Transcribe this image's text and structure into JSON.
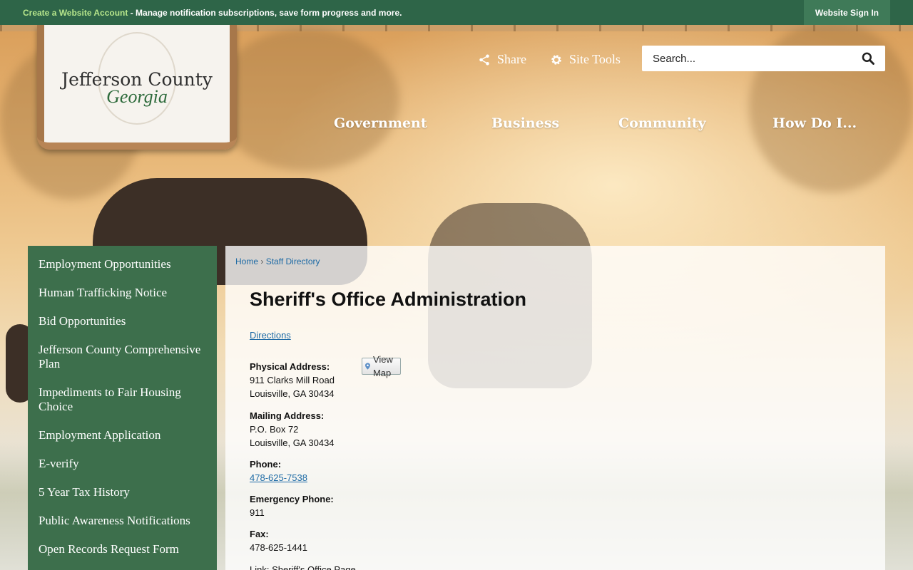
{
  "topbar": {
    "account_link": "Create a Website Account",
    "account_text": " - Manage notification subscriptions, save form progress and more.",
    "sign_in": "Website Sign In"
  },
  "logo": {
    "county": "Jefferson County",
    "state": "Georgia"
  },
  "header": {
    "share_label": "Share",
    "tools_label": "Site Tools",
    "search_placeholder": "Search..."
  },
  "nav": {
    "items": [
      "Government",
      "Business",
      "Community",
      "How Do I..."
    ]
  },
  "sidebar": {
    "items": [
      "Employment Opportunities",
      "Human Trafficking Notice",
      "Bid Opportunities",
      "Jefferson County Comprehensive Plan",
      "Impediments to Fair Housing Choice",
      "Employment Application",
      "E-verify",
      "5 Year Tax History",
      "Public Awareness Notifications",
      "Open Records Request Form"
    ]
  },
  "breadcrumb": {
    "home": "Home",
    "separator": "›",
    "current": "Staff Directory"
  },
  "page": {
    "title": "Sheriff's Office Administration",
    "directions": "Directions",
    "physical_label": "Physical Address:",
    "view_map": "View Map",
    "physical_line1": "911 Clarks Mill Road",
    "physical_line2": "Louisville, GA 30434",
    "mailing_label": "Mailing Address:",
    "mailing_line1": "P.O. Box 72",
    "mailing_line2": "Louisville, GA 30434",
    "phone_label": "Phone:",
    "phone": "478-625-7538",
    "emergency_label": "Emergency Phone:",
    "emergency": "911",
    "fax_label": "Fax:",
    "fax": "478-625-1441",
    "link_text": "Link: Sheriff's Office Page"
  },
  "colors": {
    "topbar": "#2e6548",
    "sidebar": "#3d6f4c",
    "link": "#1d6aa5",
    "account_link": "#b6e58b"
  }
}
